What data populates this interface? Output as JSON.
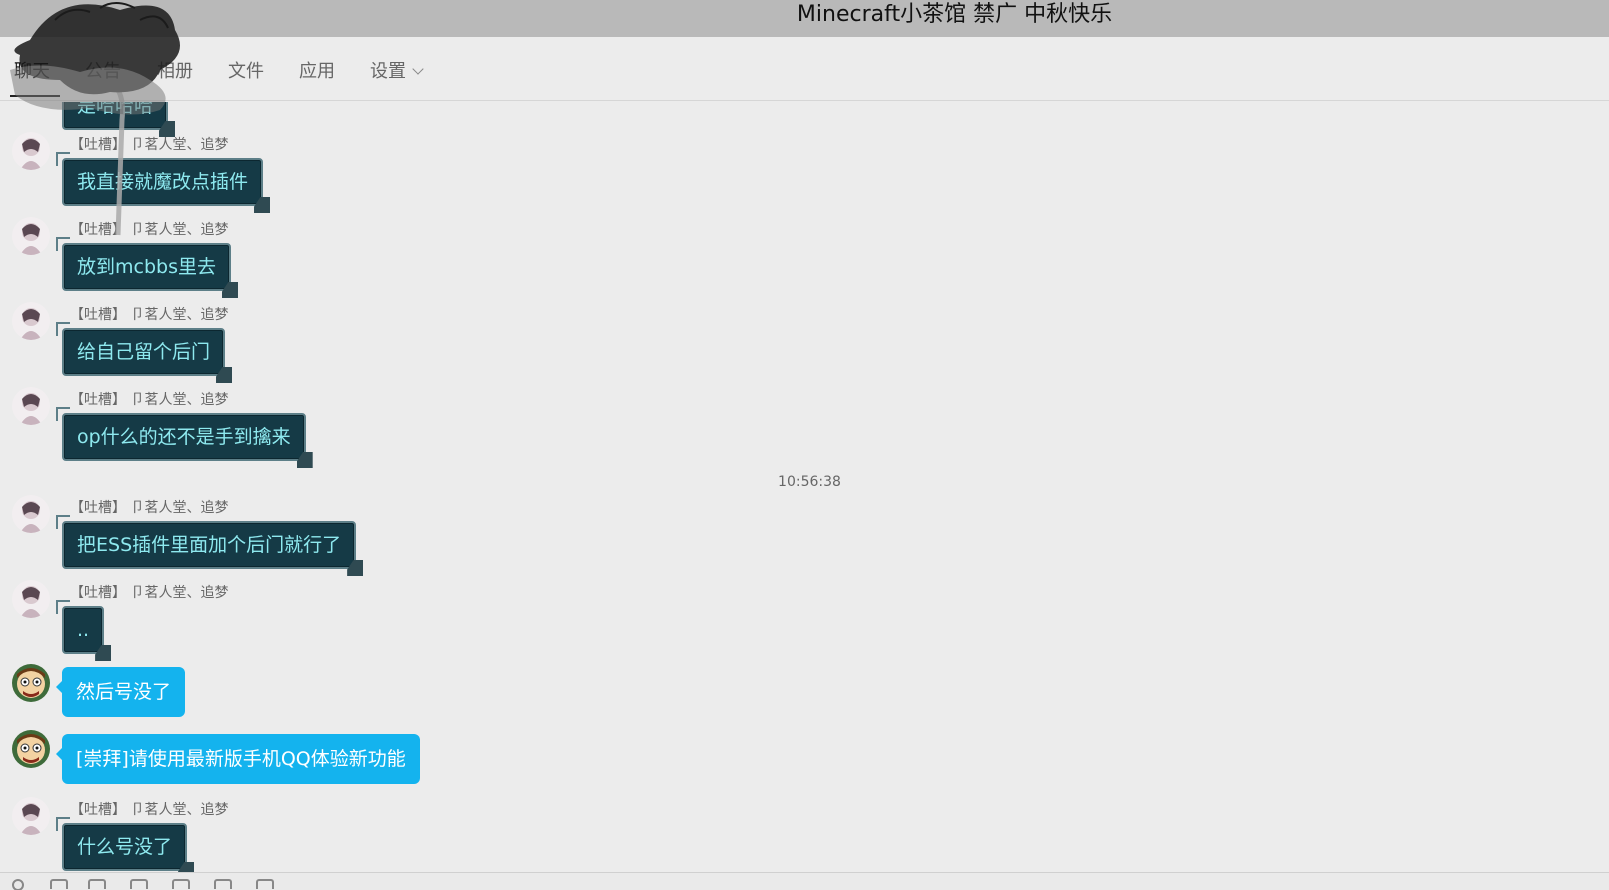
{
  "window": {
    "title": "Minecraft小茶馆 禁广 中秋快乐"
  },
  "tabs": [
    {
      "label": "聊天",
      "active": true
    },
    {
      "label": "公告",
      "active": false
    },
    {
      "label": "相册",
      "active": false
    },
    {
      "label": "文件",
      "active": false
    },
    {
      "label": "应用",
      "active": false
    },
    {
      "label": "设置",
      "active": false,
      "has_dropdown": true
    }
  ],
  "chat": {
    "partial_top_message": "是哈哈哈",
    "sender_label": "【吐槽】 卩茗人堂、追梦",
    "timestamp": "10:56:38",
    "messages": [
      {
        "sender": "【吐槽】 卩茗人堂、追梦",
        "text": "我直接就魔改点插件",
        "style": "dark"
      },
      {
        "sender": "【吐槽】 卩茗人堂、追梦",
        "text": "放到mcbbs里去",
        "style": "dark"
      },
      {
        "sender": "【吐槽】 卩茗人堂、追梦",
        "text": "给自己留个后门",
        "style": "dark"
      },
      {
        "sender": "【吐槽】 卩茗人堂、追梦",
        "text": "op什么的还不是手到擒来",
        "style": "dark"
      },
      {
        "sender": "【吐槽】 卩茗人堂、追梦",
        "text": "把ESS插件里面加个后门就行了",
        "style": "dark"
      },
      {
        "sender": "【吐槽】 卩茗人堂、追梦",
        "text": "..",
        "style": "dark"
      },
      {
        "sender": "",
        "text": "然后号没了",
        "style": "blue"
      },
      {
        "sender": "",
        "text": "[崇拜]请使用最新版手机QQ体验新功能",
        "style": "blue"
      },
      {
        "sender": "【吐槽】 卩茗人堂、追梦",
        "text": "什么号没了",
        "style": "dark"
      }
    ]
  },
  "colors": {
    "titlebar": "#b9b9b9",
    "bubble_dark_bg": "#153a46",
    "bubble_dark_text": "#8ee9ef",
    "bubble_blue_bg": "#14b3ee"
  }
}
